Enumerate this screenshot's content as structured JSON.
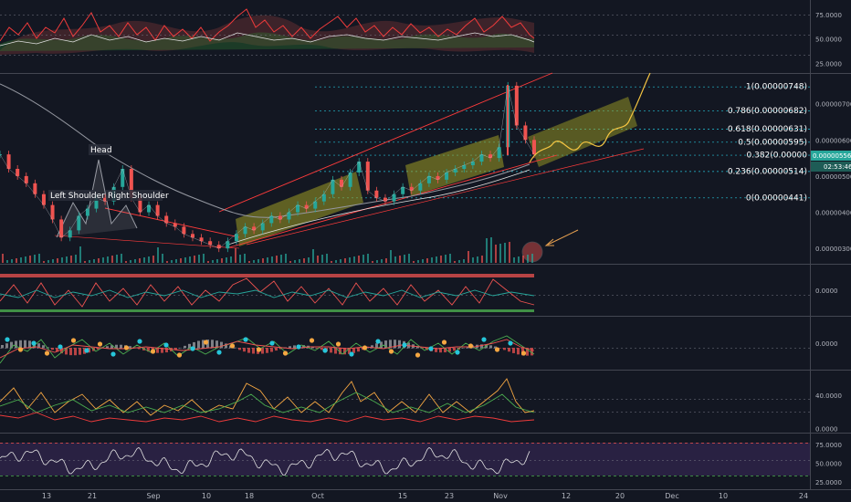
{
  "chart_data": {
    "type": "line",
    "x_axis": {
      "tick_labels": [
        "13",
        "21",
        "Sep",
        "10",
        "18",
        "Oct",
        "15",
        "23",
        "Nov",
        "12",
        "20",
        "Dec",
        "10",
        "24"
      ]
    },
    "panels": [
      {
        "name": "oscillator-top",
        "y_ticks": [
          "75.0000",
          "50.0000",
          "25.0000"
        ],
        "y_tick_values": [
          75,
          50,
          25
        ],
        "ylim": [
          15,
          90
        ]
      },
      {
        "name": "price",
        "y_ticks": [
          "0.00000700",
          "0.00000600",
          "0.00000500",
          "0.00000400",
          "0.00000300"
        ],
        "y_tick_values": [
          7e-06,
          6e-06,
          5e-06,
          4e-06,
          3e-06
        ],
        "ylim": [
          2.6e-06,
          7.8e-06
        ],
        "price_labels": [
          "0.00000556",
          "02:53:46"
        ],
        "fibonacci": [
          {
            "label": "1(0.00000748)",
            "value": 7.48e-06
          },
          {
            "label": "0.786(0.00000682)",
            "value": 6.82e-06
          },
          {
            "label": "0.618(0.00000631)",
            "value": 6.31e-06
          },
          {
            "label": "0.5(0.00000595)",
            "value": 5.95e-06
          },
          {
            "label": "0.382(0.00000",
            "value": 5.59e-06
          },
          {
            "label": "0.236(0.00000514)",
            "value": 5.14e-06
          },
          {
            "label": "0(0.00000441)",
            "value": 4.41e-06
          }
        ],
        "annotations": [
          "Head",
          "Left Shoulder",
          "Right Shoulder"
        ],
        "price_series": [
          5.6e-06,
          5.2e-06,
          5e-06,
          4.8e-06,
          4.5e-06,
          4.2e-06,
          3.8e-06,
          3.3e-06,
          3.5e-06,
          3.9e-06,
          4.1e-06,
          4.4e-06,
          4.3e-06,
          4.7e-06,
          5.2e-06,
          4.4e-06,
          4e-06,
          4.2e-06,
          3.9e-06,
          3.7e-06,
          3.6e-06,
          3.4e-06,
          3.3e-06,
          3.2e-06,
          3.1e-06,
          3e-06,
          3.2e-06,
          3.4e-06,
          3.6e-06,
          3.5e-06,
          3.7e-06,
          3.9e-06,
          3.8e-06,
          4e-06,
          4.2e-06,
          4.1e-06,
          4.3e-06,
          4.5e-06,
          4.9e-06,
          4.7e-06,
          5.1e-06,
          5.4e-06,
          4.6e-06,
          4.4e-06,
          4.3e-06,
          4.5e-06,
          4.7e-06,
          4.6e-06,
          4.8e-06,
          5e-06,
          4.9e-06,
          5.1e-06,
          5.2e-06,
          5.3e-06,
          5.4e-06,
          5.6e-06,
          5.5e-06,
          5.8e-06,
          7.5e-06,
          6.4e-06,
          6e-06,
          5.6e-06
        ]
      },
      {
        "name": "oscillator-2",
        "y_ticks": [
          "0.0000"
        ],
        "y_tick_values": [
          0
        ],
        "ylim": [
          -1,
          1
        ]
      },
      {
        "name": "macd",
        "y_ticks": [
          "0.0000"
        ],
        "y_tick_values": [
          0
        ],
        "ylim": [
          -1,
          1
        ]
      },
      {
        "name": "oscillator-4",
        "y_ticks": [
          "40.0000",
          "0.0000"
        ],
        "y_tick_values": [
          40,
          0
        ],
        "ylim": [
          -5,
          70
        ]
      },
      {
        "name": "rsi",
        "y_ticks": [
          "75.0000",
          "50.0000",
          "25.0000"
        ],
        "y_tick_values": [
          75,
          50,
          25
        ],
        "ylim": [
          15,
          90
        ],
        "bands": [
          70,
          30
        ]
      }
    ]
  },
  "colors": {
    "background": "#131722",
    "grid": "#363a45",
    "candle_up": "#26a69a",
    "candle_down": "#ef5350",
    "fib_line": "#26c6da",
    "fib_text": "#ffffff",
    "channel": "#ff3b3b",
    "fill_yellow": "#9e9d24",
    "arrow": "#e6a050",
    "projection": "#f5c542",
    "rsi_fill": "#3d2a5c"
  }
}
